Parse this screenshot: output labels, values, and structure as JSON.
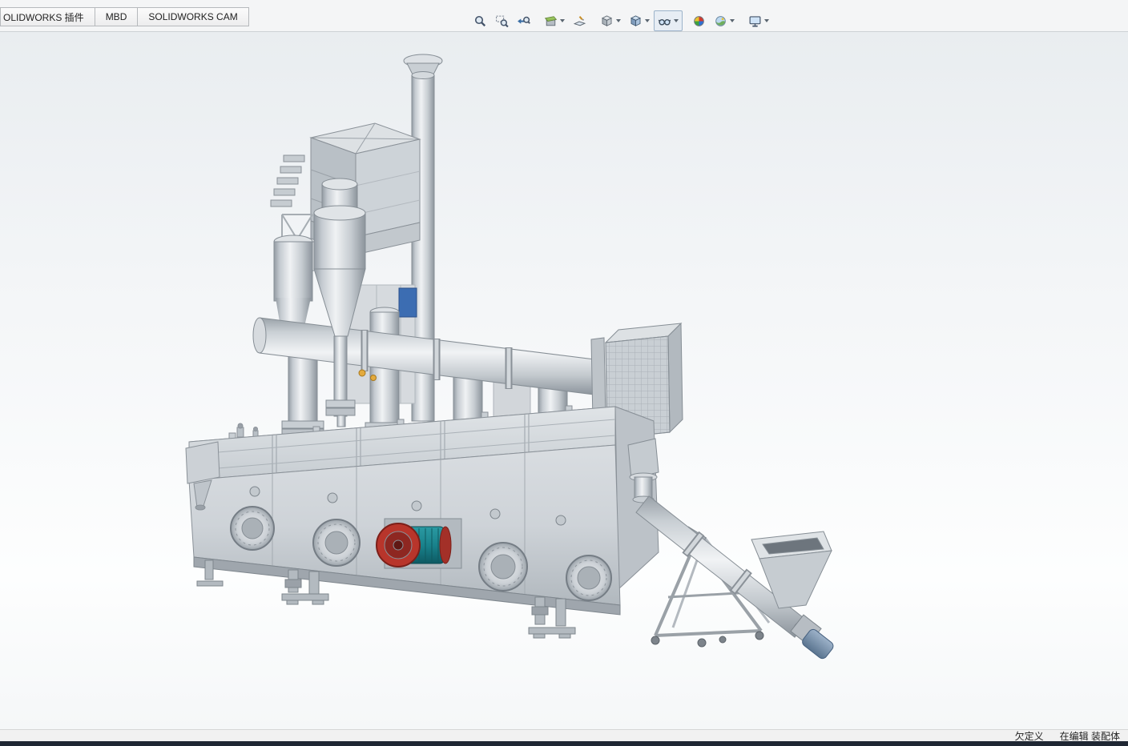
{
  "tabs": [
    {
      "label": "OLIDWORKS 插件"
    },
    {
      "label": "MBD"
    },
    {
      "label": "SOLIDWORKS CAM"
    }
  ],
  "toolbar": {
    "items": [
      {
        "icon": "zoom-to-fit-icon",
        "dropdown": false,
        "active": false
      },
      {
        "icon": "zoom-to-area-icon",
        "dropdown": false,
        "active": false
      },
      {
        "icon": "previous-view-icon",
        "dropdown": false,
        "active": false
      },
      {
        "icon": "section-view-icon",
        "dropdown": true,
        "active": false
      },
      {
        "icon": "annotation-views-icon",
        "dropdown": false,
        "active": false
      },
      {
        "icon": "view-orientation-icon",
        "dropdown": true,
        "active": false
      },
      {
        "icon": "display-style-icon",
        "dropdown": true,
        "active": false
      },
      {
        "icon": "hide-show-items-icon",
        "dropdown": true,
        "active": true
      },
      {
        "icon": "edit-appearance-icon",
        "dropdown": false,
        "active": false
      },
      {
        "icon": "apply-scene-icon",
        "dropdown": true,
        "active": false
      },
      {
        "icon": "view-settings-icon",
        "dropdown": true,
        "active": false
      }
    ]
  },
  "statusbar": {
    "state": "欠定义",
    "editing": "在编辑 装配体"
  },
  "viewport": {
    "background_top": "#e9edf0",
    "background_bottom": "#fdfefe",
    "model_parts": [
      "exhaust-stack",
      "baghouse-dust-collector",
      "cyclone-separator",
      "elbow-duct",
      "main-air-duct",
      "riser-columns",
      "air-inlet-box",
      "vibrating-fluid-bed-dryer",
      "vibration-motor",
      "inspection-doors",
      "discharge-spout",
      "screw-conveyor",
      "feed-hopper",
      "conveyor-motor",
      "conveyor-stand"
    ],
    "colors": {
      "machine_gray": "#cfd4d9",
      "motor_teal": "#19828c",
      "motor_red": "#b8352b",
      "conveyor_motor_blue": "#6b86a4",
      "detail_blue": "#3c6db2",
      "detail_yellow": "#e3aa3d"
    }
  }
}
